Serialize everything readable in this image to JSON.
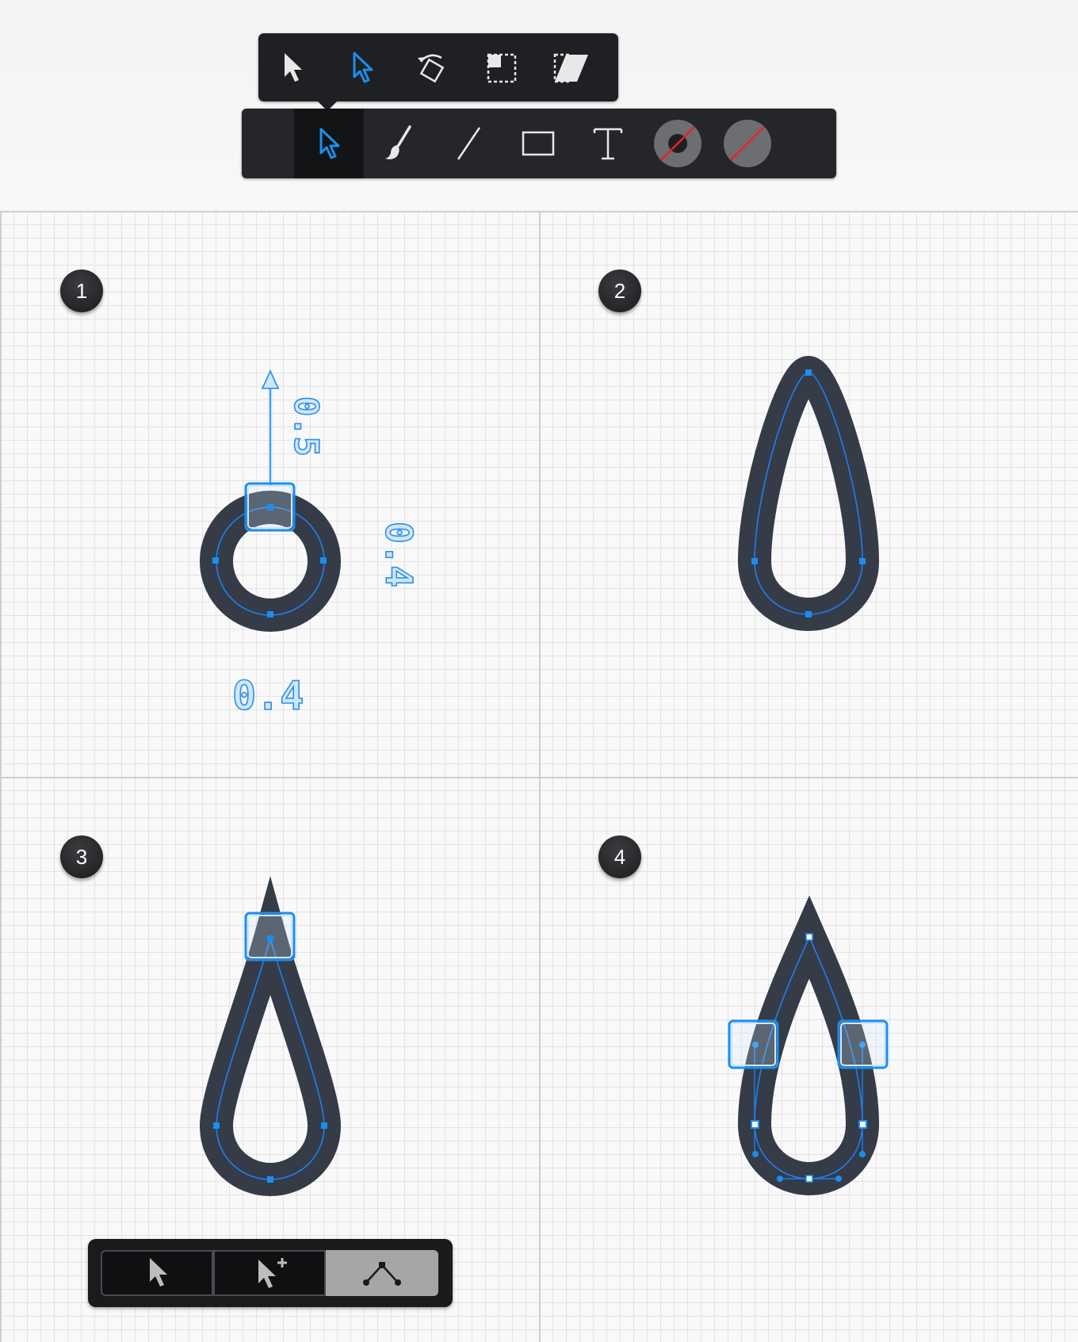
{
  "popup_toolbar": {
    "tools": [
      {
        "name": "move-tool",
        "icon": "arrow-pointer-icon"
      },
      {
        "name": "node-select-tool",
        "icon": "blue-arrow-pointer-icon"
      },
      {
        "name": "rotate-tool",
        "icon": "rotate-icon"
      },
      {
        "name": "scale-tool",
        "icon": "scale-icon"
      },
      {
        "name": "skew-tool",
        "icon": "skew-icon"
      }
    ],
    "active": "node-select-tool"
  },
  "main_toolbar": {
    "tools": [
      {
        "name": "select-tool",
        "icon": "blue-arrow-pointer-icon",
        "active": true
      },
      {
        "name": "brush-tool",
        "icon": "brush-icon"
      },
      {
        "name": "line-tool",
        "icon": "line-icon"
      },
      {
        "name": "rectangle-tool",
        "icon": "rectangle-icon"
      },
      {
        "name": "text-tool",
        "icon": "text-icon"
      },
      {
        "name": "stroke-color",
        "icon": "stroke-swatch-icon"
      },
      {
        "name": "fill-color",
        "icon": "no-fill-swatch-icon"
      }
    ]
  },
  "steps": [
    "1",
    "2",
    "3",
    "4"
  ],
  "measurements": {
    "step1_vertical_drag": "0.5",
    "step1_right": "0.4",
    "step1_bottom": "0.4"
  },
  "node_toolbar": {
    "options": [
      {
        "name": "select-node",
        "icon": "arrow-pointer-icon"
      },
      {
        "name": "add-node",
        "icon": "arrow-plus-icon"
      },
      {
        "name": "node-mode",
        "icon": "node-corner-icon",
        "selected": true
      }
    ]
  },
  "colors": {
    "shape_fill": "#353b47",
    "path_line": "#1e7ff0",
    "accent": "#1a8ef0",
    "toolbar": "#25262a"
  }
}
